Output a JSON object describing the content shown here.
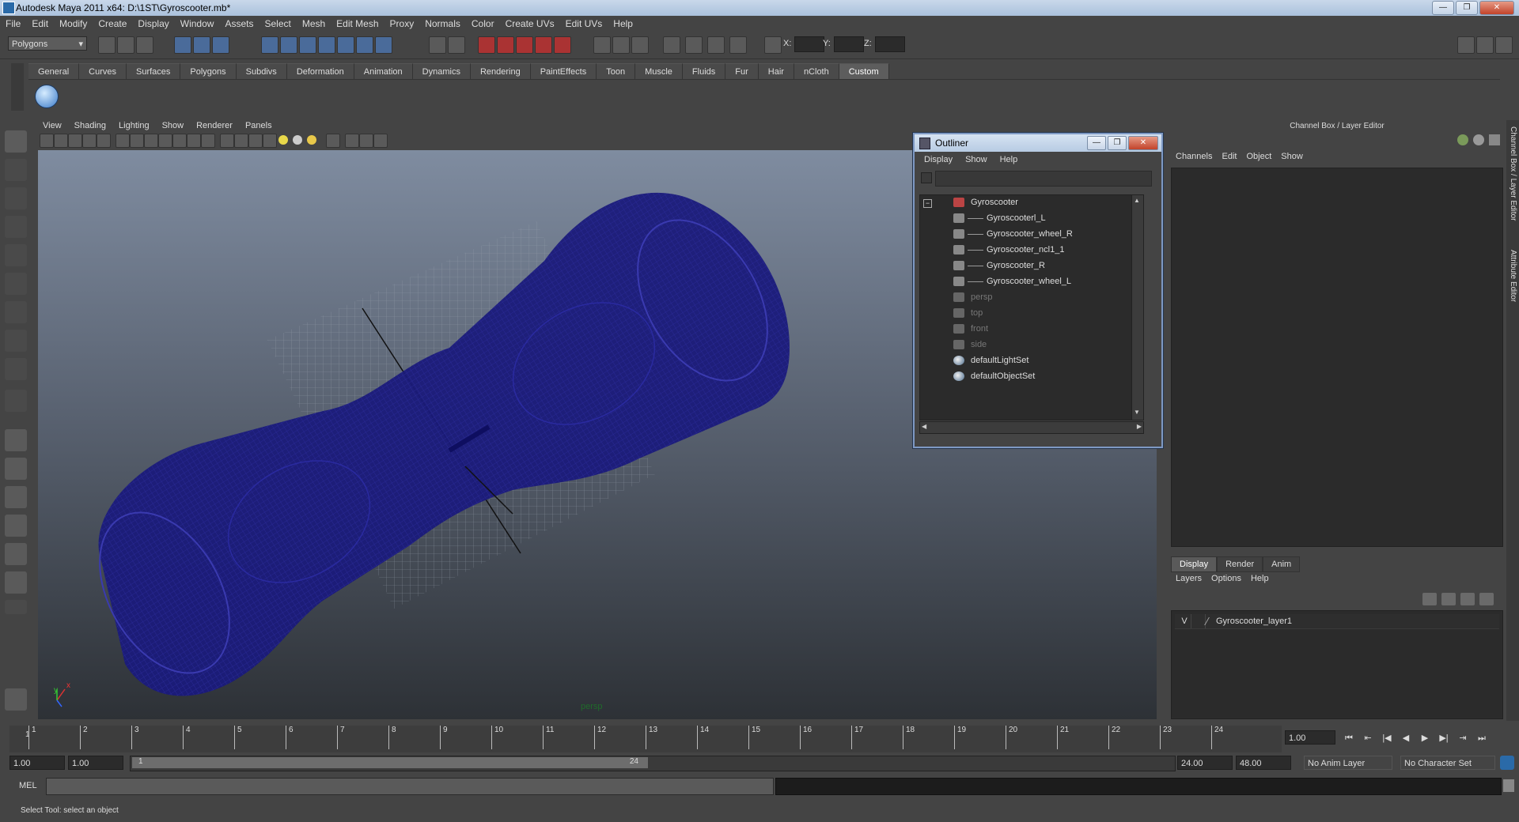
{
  "window": {
    "title": "Autodesk Maya 2011 x64: D:\\1ST\\Gyroscooter.mb*"
  },
  "menubar": [
    "File",
    "Edit",
    "Modify",
    "Create",
    "Display",
    "Window",
    "Assets",
    "Select",
    "Mesh",
    "Edit Mesh",
    "Proxy",
    "Normals",
    "Color",
    "Create UVs",
    "Edit UVs",
    "Help"
  ],
  "status": {
    "mode_menu": "Polygons",
    "x_label": "X:",
    "y_label": "Y:",
    "z_label": "Z:"
  },
  "shelf": {
    "tabs": [
      "General",
      "Curves",
      "Surfaces",
      "Polygons",
      "Subdivs",
      "Deformation",
      "Animation",
      "Dynamics",
      "Rendering",
      "PaintEffects",
      "Toon",
      "Muscle",
      "Fluids",
      "Fur",
      "Hair",
      "nCloth",
      "Custom"
    ],
    "active_tab": "Custom"
  },
  "viewport": {
    "menu": [
      "View",
      "Shading",
      "Lighting",
      "Show",
      "Renderer",
      "Panels"
    ],
    "camera_label": "persp",
    "axis_x": "x",
    "axis_y": "y",
    "wire_color": "#1a1a7a"
  },
  "outliner": {
    "title": "Outliner",
    "menu": [
      "Display",
      "Show",
      "Help"
    ],
    "items": [
      {
        "name": "Gyroscooter",
        "icon": "group-icon",
        "indent": 0,
        "dim": false
      },
      {
        "name": "Gyroscooterl_L",
        "icon": "mesh-icon",
        "indent": 1,
        "dim": false
      },
      {
        "name": "Gyroscooter_wheel_R",
        "icon": "mesh-icon",
        "indent": 1,
        "dim": false
      },
      {
        "name": "Gyroscooter_ncl1_1",
        "icon": "mesh-icon",
        "indent": 1,
        "dim": false
      },
      {
        "name": "Gyroscooter_R",
        "icon": "mesh-icon",
        "indent": 1,
        "dim": false
      },
      {
        "name": "Gyroscooter_wheel_L",
        "icon": "mesh-icon",
        "indent": 1,
        "dim": false
      },
      {
        "name": "persp",
        "icon": "camera-icon",
        "indent": 0,
        "dim": true
      },
      {
        "name": "top",
        "icon": "camera-icon",
        "indent": 0,
        "dim": true
      },
      {
        "name": "front",
        "icon": "camera-icon",
        "indent": 0,
        "dim": true
      },
      {
        "name": "side",
        "icon": "camera-icon",
        "indent": 0,
        "dim": true
      },
      {
        "name": "defaultLightSet",
        "icon": "set-icon",
        "indent": 0,
        "dim": false
      },
      {
        "name": "defaultObjectSet",
        "icon": "set-icon",
        "indent": 0,
        "dim": false
      }
    ]
  },
  "channelbox": {
    "header": "Channel Box / Layer Editor",
    "menu": [
      "Channels",
      "Edit",
      "Object",
      "Show"
    ],
    "layer_tabs": [
      "Display",
      "Render",
      "Anim"
    ],
    "layer_active": "Display",
    "layer_menu": [
      "Layers",
      "Options",
      "Help"
    ],
    "layer": {
      "visible": "V",
      "name": "Gyroscooter_layer1"
    }
  },
  "sidetabs": [
    "Channel Box / Layer Editor",
    "Attribute Editor"
  ],
  "timeline": {
    "ticks": [
      "1",
      "2",
      "3",
      "4",
      "5",
      "6",
      "7",
      "8",
      "9",
      "10",
      "11",
      "12",
      "13",
      "14",
      "15",
      "16",
      "17",
      "18",
      "19",
      "20",
      "21",
      "22",
      "23",
      "24"
    ],
    "current_frame_marker": "1",
    "current_time": "1.00"
  },
  "range": {
    "start_time": "1.00",
    "start_range": "1.00",
    "slider_start": "1",
    "slider_end": "24",
    "end_range": "24.00",
    "end_time": "48.00",
    "anim_layer": "No Anim Layer",
    "character_set": "No Character Set"
  },
  "cmdline": {
    "label": "MEL"
  },
  "helpline": {
    "text": "Select Tool: select an object"
  }
}
